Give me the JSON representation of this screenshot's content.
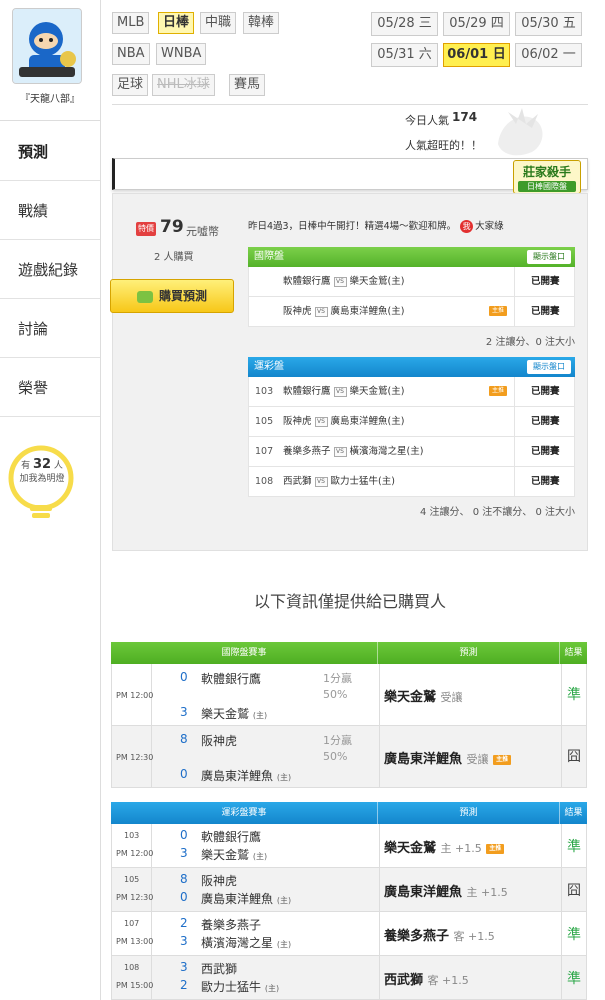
{
  "sidebar": {
    "username": "『天龍八部』",
    "items": [
      {
        "label": "預測",
        "active": true
      },
      {
        "label": "戰績"
      },
      {
        "label": "遊戲紀錄"
      },
      {
        "label": "討論"
      },
      {
        "label": "榮譽"
      }
    ],
    "fans_prefix": "有",
    "fans_count": "32",
    "fans_unit": "人",
    "fans_suffix": "加我為明燈"
  },
  "sports": [
    {
      "label": "MLB"
    },
    {
      "label": "日棒",
      "active": true
    },
    {
      "label": "中職"
    },
    {
      "label": "韓棒"
    },
    {
      "label": "NBA"
    },
    {
      "label": "WNBA"
    },
    {
      "label": "足球"
    },
    {
      "label": "NHL冰球",
      "disabled": true
    },
    {
      "label": "賽馬"
    }
  ],
  "dates": [
    {
      "label": "05/28 三"
    },
    {
      "label": "05/29 四"
    },
    {
      "label": "05/30 五"
    },
    {
      "label": "05/31 六"
    },
    {
      "label": "06/01 日",
      "active": true
    },
    {
      "label": "06/02 一"
    }
  ],
  "popularity": {
    "label": "今日人氣",
    "value": "174",
    "note": "人氣超旺的！！"
  },
  "badge": {
    "title": "莊家殺手",
    "subtitle": "日棒國際盤"
  },
  "purchase": {
    "tag": "特價",
    "price": "79",
    "unit": "元噓幣",
    "buyers": "2 人購買",
    "button": "購買預測"
  },
  "news": {
    "text": "昨日4過3，日棒中午開打！精選4場～歡迎和牌。",
    "badge": "我",
    "author": "大家綠"
  },
  "intl_odds": {
    "title": "國際盤",
    "button": "顯示盤口",
    "rows": [
      {
        "home": "軟體銀行鷹",
        "vs": "VS",
        "away": "樂天金鷲(主)",
        "status": "已開賽",
        "flag": false
      },
      {
        "home": "阪神虎",
        "vs": "VS",
        "away": "廣島東洋鯉魚(主)",
        "status": "已開賽",
        "flag": true
      }
    ],
    "summary": "2 注讓分、0 注大小"
  },
  "lottery_odds": {
    "title": "運彩盤",
    "button": "顯示盤口",
    "rows": [
      {
        "id": "103",
        "home": "軟體銀行鷹",
        "vs": "VS",
        "away": "樂天金鷲(主)",
        "status": "已開賽",
        "flag": true
      },
      {
        "id": "105",
        "home": "阪神虎",
        "vs": "VS",
        "away": "廣島東洋鯉魚(主)",
        "status": "已開賽",
        "flag": false
      },
      {
        "id": "107",
        "home": "養樂多燕子",
        "vs": "VS",
        "away": "橫濱海灣之星(主)",
        "status": "已開賽",
        "flag": false
      },
      {
        "id": "108",
        "home": "西武獅",
        "vs": "VS",
        "away": "歐力士猛牛(主)",
        "status": "已開賽",
        "flag": false
      }
    ],
    "summary": "4 注讓分、 0 注不讓分、 0 注大小"
  },
  "rt_label": "主推",
  "notice": "以下資訊僅提供給已購買人",
  "intl_table": {
    "headers": [
      "國際盤賽事",
      "預測",
      "結果"
    ],
    "rows": [
      {
        "time": "PM 12:00",
        "s1": "0",
        "t1": "軟體銀行鷹",
        "s2": "3",
        "t2": "樂天金鷲",
        "t2tag": "(主)",
        "odds1": "1分贏",
        "odds2": "50%",
        "pick": "樂天金鷲",
        "note": "受讓",
        "result": "準",
        "win": true,
        "flag": false
      },
      {
        "time": "PM 12:30",
        "s1": "8",
        "t1": "阪神虎",
        "s2": "0",
        "t2": "廣島東洋鯉魚",
        "t2tag": "(主)",
        "odds1": "1分贏",
        "odds2": "50%",
        "pick": "廣島東洋鯉魚",
        "note": "受讓",
        "result": "囧",
        "win": false,
        "flag": true
      }
    ]
  },
  "lottery_table": {
    "headers": [
      "運彩盤賽事",
      "預測",
      "結果"
    ],
    "rows": [
      {
        "id": "103",
        "time": "PM 12:00",
        "s1": "0",
        "t1": "軟體銀行鷹",
        "s2": "3",
        "t2": "樂天金鷲",
        "t2tag": "(主)",
        "pick": "樂天金鷲",
        "note": "主 +1.5",
        "result": "準",
        "win": true,
        "flag": true
      },
      {
        "id": "105",
        "time": "PM 12:30",
        "s1": "8",
        "t1": "阪神虎",
        "s2": "0",
        "t2": "廣島東洋鯉魚",
        "t2tag": "(主)",
        "pick": "廣島東洋鯉魚",
        "note": "主 +1.5",
        "result": "囧",
        "win": false,
        "flag": false
      },
      {
        "id": "107",
        "time": "PM 13:00",
        "s1": "2",
        "t1": "養樂多燕子",
        "s2": "3",
        "t2": "橫濱海灣之星",
        "t2tag": "(主)",
        "pick": "養樂多燕子",
        "note": "客 +1.5",
        "result": "準",
        "win": true,
        "flag": false
      },
      {
        "id": "108",
        "time": "PM 15:00",
        "s1": "3",
        "t1": "西武獅",
        "s2": "2",
        "t2": "歐力士猛牛",
        "t2tag": "(主)",
        "pick": "西武獅",
        "note": "客 +1.5",
        "result": "準",
        "win": true,
        "flag": false
      }
    ]
  }
}
